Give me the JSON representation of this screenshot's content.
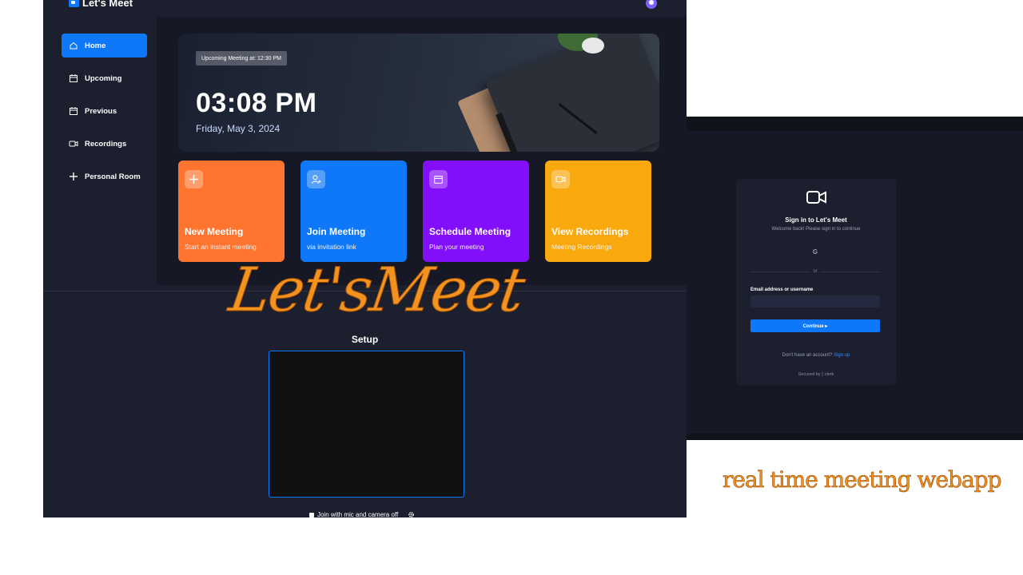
{
  "app": {
    "brand": "Let's Meet"
  },
  "sidebar": {
    "items": [
      {
        "label": "Home",
        "icon": "home-icon"
      },
      {
        "label": "Upcoming",
        "icon": "calendar-upcoming-icon"
      },
      {
        "label": "Previous",
        "icon": "calendar-previous-icon"
      },
      {
        "label": "Recordings",
        "icon": "video-icon"
      },
      {
        "label": "Personal Room",
        "icon": "plus-icon"
      }
    ]
  },
  "hero": {
    "upcoming": "Upcoming Meeting at: 12:30 PM",
    "time": "03:08 PM",
    "date": "Friday, May 3, 2024"
  },
  "cards": [
    {
      "title": "New Meeting",
      "subtitle": "Start an instant meeting",
      "icon": "plus-icon",
      "color": "#ff742e"
    },
    {
      "title": "Join Meeting",
      "subtitle": "via invitation link",
      "icon": "user-add-icon",
      "color": "#0e78f9"
    },
    {
      "title": "Schedule Meeting",
      "subtitle": "Plan your meeting",
      "icon": "calendar-icon",
      "color": "#830ef9"
    },
    {
      "title": "View Recordings",
      "subtitle": "Meeting Recordings",
      "icon": "video-icon",
      "color": "#f9a90e"
    }
  ],
  "setup": {
    "title": "Setup",
    "join_label": "Join with mic and camera off"
  },
  "overlay": {
    "title": "Let'sMeet",
    "tagline": "real time meeting webapp"
  },
  "signin": {
    "title": "Sign in to Let's Meet",
    "subtitle": "Welcome back! Please sign in to continue",
    "google": "G",
    "or": "or",
    "email_label": "Email address or username",
    "continue": "Continue  ▸",
    "no_account": "Don't have an account?",
    "signup": "Sign up",
    "secured": "Secured by ⟆ clerk"
  }
}
